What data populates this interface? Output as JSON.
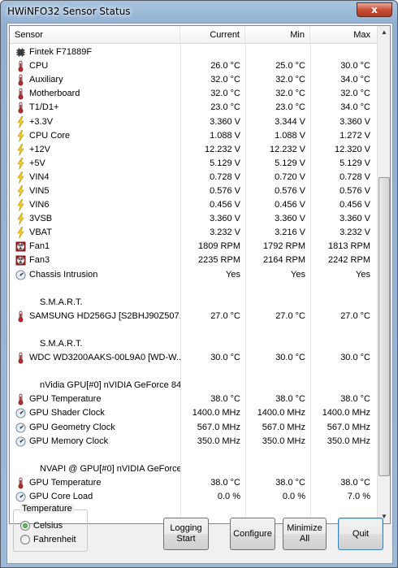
{
  "window": {
    "title": "HWiNFO32 Sensor Status",
    "close_glyph": "x"
  },
  "columns": [
    "Sensor",
    "Current",
    "Min",
    "Max"
  ],
  "rows": [
    {
      "type": "header",
      "icon": "chip-icon",
      "label": "Fintek F71889F",
      "current": "",
      "min": "",
      "max": ""
    },
    {
      "type": "data",
      "icon": "thermometer-icon",
      "label": "CPU",
      "current": "26.0 °C",
      "min": "25.0 °C",
      "max": "30.0 °C"
    },
    {
      "type": "data",
      "icon": "thermometer-icon",
      "label": "Auxiliary",
      "current": "32.0 °C",
      "min": "32.0 °C",
      "max": "34.0 °C"
    },
    {
      "type": "data",
      "icon": "thermometer-icon",
      "label": "Motherboard",
      "current": "32.0 °C",
      "min": "32.0 °C",
      "max": "32.0 °C"
    },
    {
      "type": "data",
      "icon": "thermometer-icon",
      "label": "T1/D1+",
      "current": "23.0 °C",
      "min": "23.0 °C",
      "max": "34.0 °C"
    },
    {
      "type": "data",
      "icon": "voltage-bolt-icon",
      "label": "+3.3V",
      "current": "3.360 V",
      "min": "3.344 V",
      "max": "3.360 V"
    },
    {
      "type": "data",
      "icon": "voltage-bolt-icon",
      "label": "CPU Core",
      "current": "1.088 V",
      "min": "1.088 V",
      "max": "1.272 V"
    },
    {
      "type": "data",
      "icon": "voltage-bolt-icon",
      "label": "+12V",
      "current": "12.232 V",
      "min": "12.232 V",
      "max": "12.320 V"
    },
    {
      "type": "data",
      "icon": "voltage-bolt-icon",
      "label": "+5V",
      "current": "5.129 V",
      "min": "5.129 V",
      "max": "5.129 V"
    },
    {
      "type": "data",
      "icon": "voltage-bolt-icon",
      "label": "VIN4",
      "current": "0.728 V",
      "min": "0.720 V",
      "max": "0.728 V"
    },
    {
      "type": "data",
      "icon": "voltage-bolt-icon",
      "label": "VIN5",
      "current": "0.576 V",
      "min": "0.576 V",
      "max": "0.576 V"
    },
    {
      "type": "data",
      "icon": "voltage-bolt-icon",
      "label": "VIN6",
      "current": "0.456 V",
      "min": "0.456 V",
      "max": "0.456 V"
    },
    {
      "type": "data",
      "icon": "voltage-bolt-icon",
      "label": "3VSB",
      "current": "3.360 V",
      "min": "3.360 V",
      "max": "3.360 V"
    },
    {
      "type": "data",
      "icon": "voltage-bolt-icon",
      "label": "VBAT",
      "current": "3.232 V",
      "min": "3.216 V",
      "max": "3.232 V"
    },
    {
      "type": "data",
      "icon": "fan-icon",
      "label": "Fan1",
      "current": "1809 RPM",
      "min": "1792 RPM",
      "max": "1813 RPM"
    },
    {
      "type": "data",
      "icon": "fan-icon",
      "label": "Fan3",
      "current": "2235 RPM",
      "min": "2164 RPM",
      "max": "2242 RPM"
    },
    {
      "type": "data",
      "icon": "gauge-icon",
      "label": "Chassis Intrusion",
      "current": "Yes",
      "min": "Yes",
      "max": "Yes"
    },
    {
      "type": "blank",
      "icon": "",
      "label": "",
      "current": "",
      "min": "",
      "max": ""
    },
    {
      "type": "header",
      "icon": "",
      "label": "S.M.A.R.T.",
      "current": "",
      "min": "",
      "max": ""
    },
    {
      "type": "data",
      "icon": "thermometer-icon",
      "label": "SAMSUNG HD256GJ [S2BHJ90Z507...",
      "current": "27.0 °C",
      "min": "27.0 °C",
      "max": "27.0 °C"
    },
    {
      "type": "blank",
      "icon": "",
      "label": "",
      "current": "",
      "min": "",
      "max": ""
    },
    {
      "type": "header",
      "icon": "",
      "label": "S.M.A.R.T.",
      "current": "",
      "min": "",
      "max": ""
    },
    {
      "type": "data",
      "icon": "thermometer-icon",
      "label": "WDC WD3200AAKS-00L9A0 [WD-W...",
      "current": "30.0 °C",
      "min": "30.0 °C",
      "max": "30.0 °C"
    },
    {
      "type": "blank",
      "icon": "",
      "label": "",
      "current": "",
      "min": "",
      "max": ""
    },
    {
      "type": "header",
      "icon": "",
      "label": "nVidia GPU[#0] nVIDIA GeForce 84...",
      "current": "",
      "min": "",
      "max": ""
    },
    {
      "type": "data",
      "icon": "thermometer-icon",
      "label": "GPU Temperature",
      "current": "38.0 °C",
      "min": "38.0 °C",
      "max": "38.0 °C"
    },
    {
      "type": "data",
      "icon": "gauge-icon",
      "label": "GPU Shader Clock",
      "current": "1400.0 MHz",
      "min": "1400.0 MHz",
      "max": "1400.0 MHz"
    },
    {
      "type": "data",
      "icon": "gauge-icon",
      "label": "GPU Geometry Clock",
      "current": "567.0 MHz",
      "min": "567.0 MHz",
      "max": "567.0 MHz"
    },
    {
      "type": "data",
      "icon": "gauge-icon",
      "label": "GPU Memory Clock",
      "current": "350.0 MHz",
      "min": "350.0 MHz",
      "max": "350.0 MHz"
    },
    {
      "type": "blank",
      "icon": "",
      "label": "",
      "current": "",
      "min": "",
      "max": ""
    },
    {
      "type": "header",
      "icon": "",
      "label": "NVAPI @ GPU[#0] nVIDIA GeForce ...",
      "current": "",
      "min": "",
      "max": ""
    },
    {
      "type": "data",
      "icon": "thermometer-icon",
      "label": "GPU Temperature",
      "current": "38.0 °C",
      "min": "38.0 °C",
      "max": "38.0 °C"
    },
    {
      "type": "data",
      "icon": "gauge-icon",
      "label": "GPU Core Load",
      "current": "0.0 %",
      "min": "0.0 %",
      "max": "7.0 %"
    }
  ],
  "temperature_group": {
    "title": "Temperature",
    "options": [
      "Celsius",
      "Fahrenheit"
    ],
    "selected": "Celsius"
  },
  "buttons": {
    "logging_line1": "Logging",
    "logging_line2": "Start",
    "configure": "Configure",
    "minimize_line1": "Minimize",
    "minimize_line2": "All",
    "quit": "Quit"
  },
  "scroll": {
    "up_glyph": "▲",
    "down_glyph": "▼"
  }
}
